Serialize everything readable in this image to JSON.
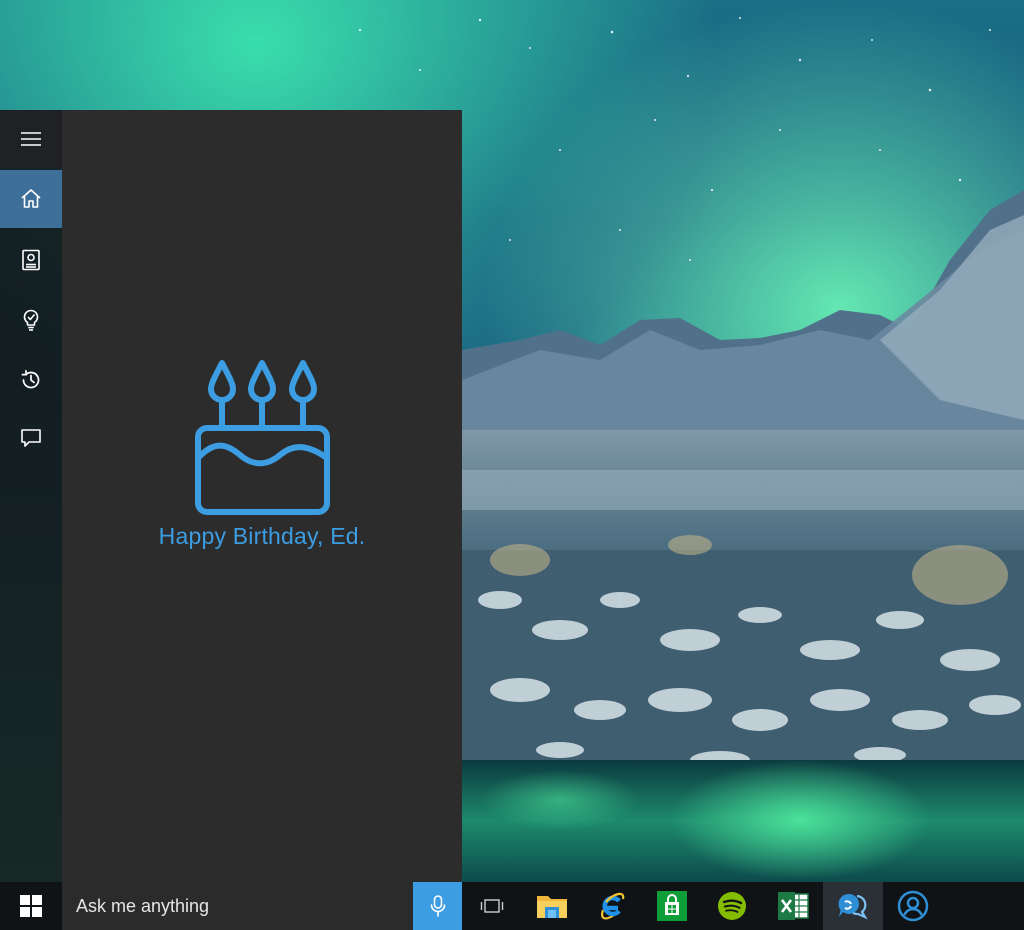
{
  "cortana": {
    "greeting": "Happy Birthday, Ed.",
    "nav": [
      {
        "icon": "hamburger-menu-icon"
      },
      {
        "icon": "home-icon",
        "selected": true
      },
      {
        "icon": "notebook-icon"
      },
      {
        "icon": "lightbulb-reminders-icon"
      },
      {
        "icon": "history-icon"
      },
      {
        "icon": "feedback-icon"
      }
    ]
  },
  "taskbar": {
    "search_placeholder": "Ask me anything",
    "buttons": [
      {
        "icon": "task-view-icon"
      },
      {
        "icon": "file-explorer-icon"
      },
      {
        "icon": "internet-explorer-icon"
      },
      {
        "icon": "store-icon"
      },
      {
        "icon": "spotify-icon"
      },
      {
        "icon": "excel-icon"
      },
      {
        "icon": "skype-icon"
      },
      {
        "icon": "people-icon"
      }
    ]
  },
  "colors": {
    "accent": "#3d9de2",
    "panel_bg": "#2c2c2c",
    "rail_bg": "#121416",
    "nav_selected": "#3e6f99",
    "taskbar_bg": "#101316"
  }
}
